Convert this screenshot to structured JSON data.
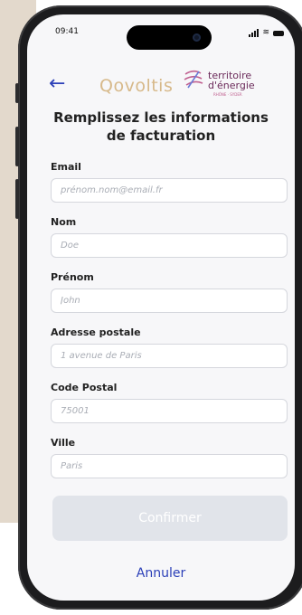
{
  "status_bar": {
    "time": "09:41"
  },
  "header": {
    "back_icon": "arrow-left-icon",
    "brand1": "Qovoltis",
    "brand2_line1": "territoire",
    "brand2_line2": "d'énergie",
    "brand2_sub": "RHÔNE · SYDER"
  },
  "title": "Remplissez les informations de facturation",
  "form": {
    "email": {
      "label": "Email",
      "placeholder": "prénom.nom@email.fr"
    },
    "nom": {
      "label": "Nom",
      "placeholder": "Doe"
    },
    "prenom": {
      "label": "Prénom",
      "placeholder": "John"
    },
    "adresse": {
      "label": "Adresse postale",
      "placeholder": "1 avenue de Paris"
    },
    "code_postal": {
      "label": "Code Postal",
      "placeholder": "75001"
    },
    "ville": {
      "label": "Ville",
      "placeholder": "Paris"
    }
  },
  "actions": {
    "confirm": "Confirmer",
    "cancel": "Annuler"
  },
  "colors": {
    "accent": "#2b3fb8",
    "disabled_button": "#e1e4ea",
    "beige_panel": "#e3d9cc"
  }
}
